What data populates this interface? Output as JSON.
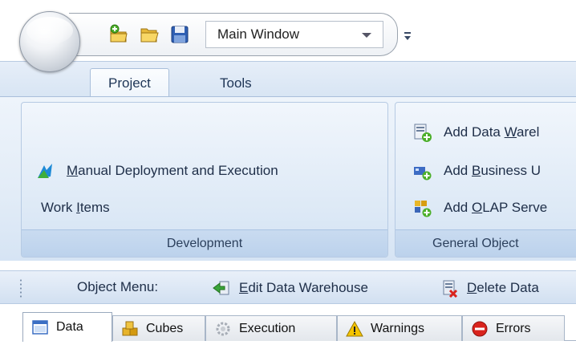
{
  "quick_access": {
    "window_combo_value": "Main Window",
    "buttons": [
      "new-project-icon",
      "open-folder-icon",
      "save-disk-icon"
    ],
    "customize_glyph": "▾"
  },
  "ribbon": {
    "tabs": [
      {
        "label": "Project",
        "active": true
      },
      {
        "label": "Tools",
        "active": false
      }
    ],
    "groups": {
      "development": {
        "label": "Development",
        "items": [
          {
            "pre": "",
            "key": "M",
            "post": "anual Deployment and Execution",
            "icon": "deploy-arrows-icon"
          },
          {
            "pre": "Work ",
            "key": "I",
            "post": "tems",
            "icon": ""
          }
        ]
      },
      "general_objects": {
        "label": "General Object",
        "items": [
          {
            "pre": "Add Data ",
            "key": "W",
            "post": "arel",
            "icon": "add-data-warehouse-icon"
          },
          {
            "pre": "Add ",
            "key": "B",
            "post": "usiness U",
            "icon": "add-business-unit-icon"
          },
          {
            "pre": "Add ",
            "key": "O",
            "post": "LAP Serve",
            "icon": "add-olap-server-icon"
          }
        ]
      }
    }
  },
  "object_menu": {
    "label": "Object Menu:",
    "items": [
      {
        "pre": "",
        "key": "E",
        "post": "dit Data Warehouse",
        "icon": "edit-data-warehouse-icon"
      },
      {
        "pre": "",
        "key": "D",
        "post": "elete Data",
        "icon": "delete-data-warehouse-icon"
      }
    ]
  },
  "bottom_tabs": [
    {
      "label": "Data",
      "icon": "data-grid-icon",
      "active": true
    },
    {
      "label": "Cubes",
      "icon": "cubes-icon",
      "active": false
    },
    {
      "label": "Execution",
      "icon": "gear-icon",
      "active": false
    },
    {
      "label": "Warnings",
      "icon": "warning-icon",
      "active": false
    },
    {
      "label": "Errors",
      "icon": "error-icon",
      "active": false
    }
  ],
  "colors": {
    "ribbon_bg": "#dde9f6",
    "group_label_bg": "#c9dbf0",
    "text_dark": "#1e2e48",
    "warning_yellow": "#f5c400",
    "error_red": "#d9231d"
  }
}
